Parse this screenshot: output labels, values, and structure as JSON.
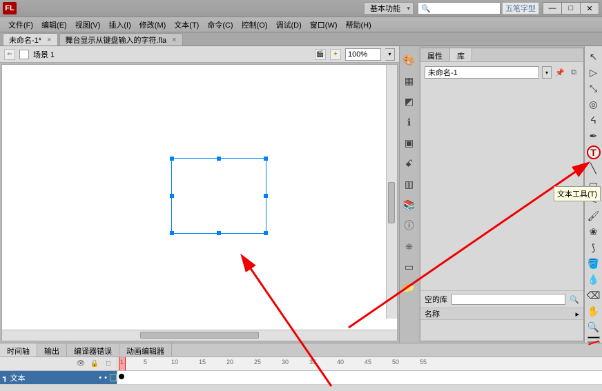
{
  "app": {
    "logo": "FL",
    "workspace_label": "基本功能",
    "search_placeholder": "",
    "ime_label": "五笔字型"
  },
  "window_buttons": {
    "min": "—",
    "max": "□",
    "close": "✕"
  },
  "menu": [
    "文件(F)",
    "编辑(E)",
    "视图(V)",
    "插入(I)",
    "修改(M)",
    "文本(T)",
    "命令(C)",
    "控制(O)",
    "调试(D)",
    "窗口(W)",
    "帮助(H)"
  ],
  "doc_tabs": [
    {
      "label": "未命名-1*",
      "active": true
    },
    {
      "label": "舞台显示从键盘输入的字符.fla",
      "active": false
    }
  ],
  "stage": {
    "back_icon": "⇐",
    "scene_label": "场景 1",
    "zoom": "100%"
  },
  "right_panel": {
    "tabs": {
      "properties": "属性",
      "library": "库"
    },
    "doc_name": "未命名-1",
    "empty_label": "空的库",
    "name_header": "名称",
    "menu_glyph": "▸"
  },
  "tool_tooltip": "文本工具(T)",
  "tool_glyphs": {
    "arrow": "↖",
    "subselect": "▷",
    "free": "⤡",
    "threeD": "◎",
    "lasso": "ᔦ",
    "pen": "✒",
    "text": "T",
    "line": "╲",
    "rect": "▭",
    "pencil": "✎",
    "brush": "🖌",
    "deco": "❀",
    "bone": "⟆",
    "paint": "🪣",
    "ink": "💧",
    "eraser": "⌫",
    "hand": "✋",
    "zoom": "🔍"
  },
  "side_dock": [
    "🎨",
    "▦",
    "◩",
    "ℹ",
    "▣",
    "ꗃ",
    "▥",
    "",
    "📚",
    "ⓘ",
    "⎈",
    "",
    "▭",
    "📂"
  ],
  "bottom_tabs": [
    "时间轴",
    "输出",
    "编译器错误",
    "动画编辑器"
  ],
  "layer": {
    "name": "文本"
  },
  "frame_numbers": [
    "1",
    "5",
    "10",
    "15",
    "20",
    "25",
    "30",
    "35",
    "40",
    "45",
    "50",
    "55"
  ]
}
